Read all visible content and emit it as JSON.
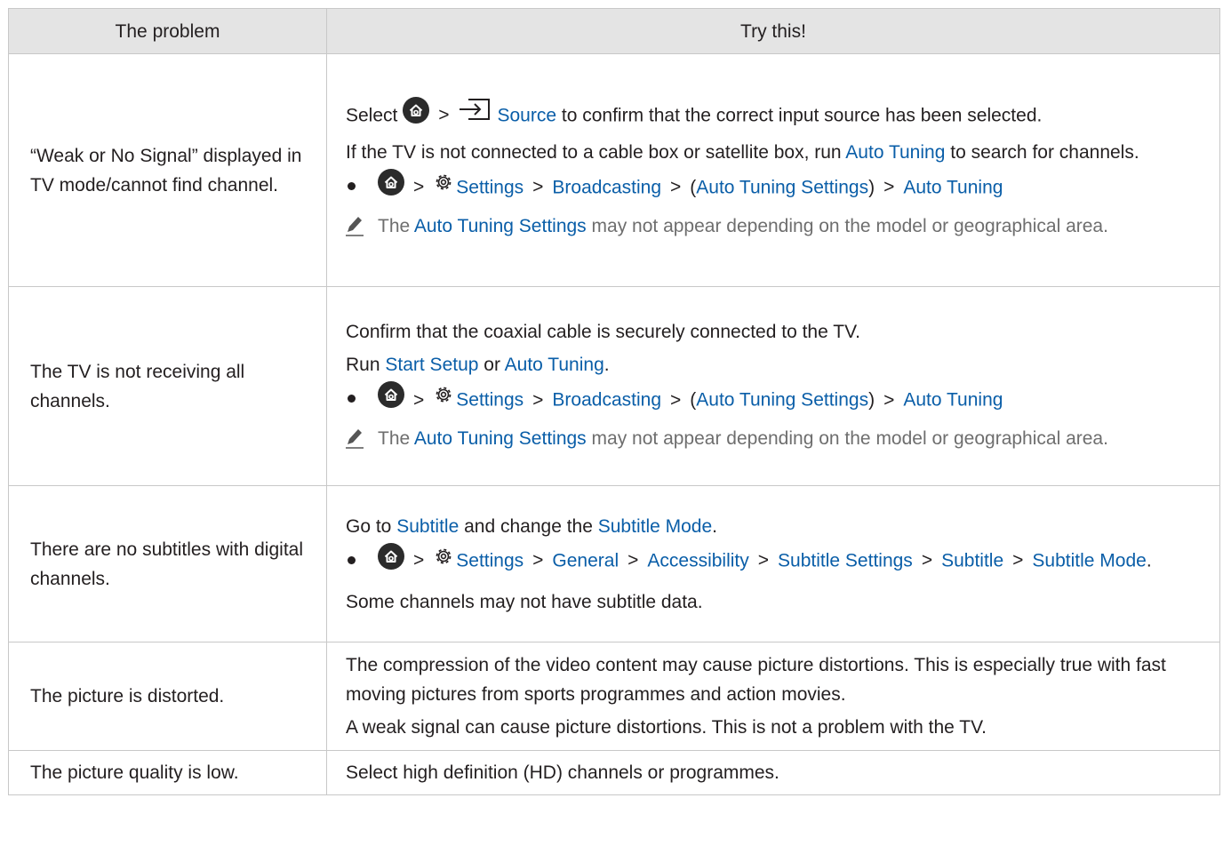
{
  "header": {
    "col_problem": "The problem",
    "col_fix": "Try this!"
  },
  "rows": [
    {
      "problem": "“Weak or No Signal” displayed in TV mode/cannot find channel.",
      "select_pre": "Select",
      "source_label": "Source",
      "select_post": "to confirm that the correct input source has been selected.",
      "line2_pre": "If the TV is not connected to a cable box or satellite box, run",
      "line2_link": "Auto Tuning",
      "line2_post": "to search for channels.",
      "path": [
        "Settings",
        "Broadcasting",
        "Auto Tuning Settings",
        "Auto Tuning"
      ],
      "note_pre": "The",
      "note_link": "Auto Tuning Settings",
      "note_post": "may not appear depending on the model or geographical area."
    },
    {
      "problem": "The TV is not receiving all channels.",
      "line1": "Confirm that the coaxial cable is securely connected to the TV.",
      "run_pre": "Run",
      "run_link1": "Start Setup",
      "run_or": "or",
      "run_link2": "Auto Tuning",
      "path": [
        "Settings",
        "Broadcasting",
        "Auto Tuning Settings",
        "Auto Tuning"
      ],
      "note_pre": "The",
      "note_link": "Auto Tuning Settings",
      "note_post": "may not appear depending on the model or geographical area."
    },
    {
      "problem": "There are no subtitles with digital channels.",
      "goto_pre": "Go to",
      "goto_link1": "Subtitle",
      "goto_mid": "and change the",
      "goto_link2": "Subtitle Mode",
      "path": [
        "Settings",
        "General",
        "Accessibility",
        "Subtitle Settings",
        "Subtitle",
        "Subtitle Mode"
      ],
      "line3": "Some channels may not have subtitle data."
    },
    {
      "problem": "The picture is distorted.",
      "line1": "The compression of the video content may cause picture distortions. This is especially true with fast moving pictures from sports programmes and action movies.",
      "line2": "A weak signal can cause picture distortions. This is not a problem with the TV."
    },
    {
      "problem": "The picture quality is low.",
      "line1": "Select high definition (HD) channels or programmes."
    }
  ],
  "colors": {
    "link": "#0a5ea8",
    "header_bg": "#e4e4e4",
    "border": "#c8c8c8",
    "note_text": "#6e6e6e"
  }
}
